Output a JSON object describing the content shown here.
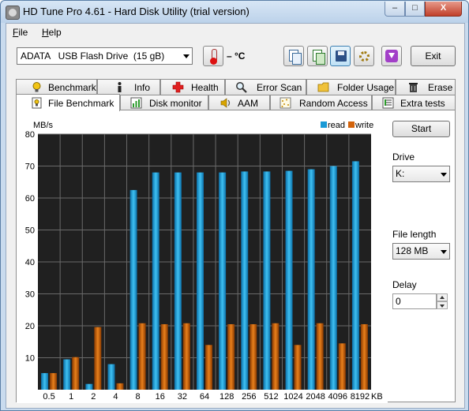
{
  "window": {
    "title": "HD Tune Pro 4.61 - Hard Disk Utility (trial version)",
    "minimize": "–",
    "maximize": "□",
    "close": "X"
  },
  "menu": {
    "file": "F",
    "file_rest": "ile",
    "help": "H",
    "help_rest": "elp"
  },
  "toolbar": {
    "drive_label": "ADATA   USB Flash Drive  (15 gB)",
    "temperature": "– °C",
    "exit_label": "Exit",
    "buttons": [
      "copy-text-icon",
      "copy-screenshot-icon",
      "save-icon",
      "options-icon",
      "download-icon"
    ]
  },
  "tabs_row1": [
    {
      "label": "Benchmark",
      "icon": "lightbulb-icon"
    },
    {
      "label": "Info",
      "icon": "info-icon"
    },
    {
      "label": "Health",
      "icon": "health-cross-icon"
    },
    {
      "label": "Error Scan",
      "icon": "magnifier-icon"
    },
    {
      "label": "Folder Usage",
      "icon": "folder-icon"
    },
    {
      "label": "Erase",
      "icon": "trash-icon"
    }
  ],
  "tabs_row2": [
    {
      "label": "File Benchmark",
      "icon": "file-benchmark-icon",
      "active": true
    },
    {
      "label": "Disk monitor",
      "icon": "disk-monitor-icon"
    },
    {
      "label": "AAM",
      "icon": "speaker-icon"
    },
    {
      "label": "Random Access",
      "icon": "random-access-icon"
    },
    {
      "label": "Extra tests",
      "icon": "extra-tests-icon"
    }
  ],
  "controls": {
    "start_label": "Start",
    "drive_label": "Drive",
    "drive_value": "K:",
    "file_length_label": "File length",
    "file_length_value": "128 MB",
    "delay_label": "Delay",
    "delay_value": "0"
  },
  "colors": {
    "read": "#1a9ad6",
    "write": "#d2630c",
    "plot_bg": "#202020",
    "grid": "#6a6a6a"
  },
  "chart_data": {
    "type": "bar",
    "ylabel": "MB/s",
    "xunit": "KB",
    "ylim": [
      0,
      80
    ],
    "yticks": [
      10,
      20,
      30,
      40,
      50,
      60,
      70,
      80
    ],
    "grid": true,
    "legend_position": "top-right",
    "categories": [
      "0.5",
      "1",
      "2",
      "4",
      "8",
      "16",
      "32",
      "64",
      "128",
      "256",
      "512",
      "1024",
      "2048",
      "4096",
      "8192"
    ],
    "series": [
      {
        "name": "read",
        "values": [
          5.2,
          9.5,
          1.8,
          8.0,
          62.5,
          68.0,
          68.0,
          68.0,
          68.0,
          68.3,
          68.3,
          68.5,
          69.0,
          70.0,
          71.5
        ]
      },
      {
        "name": "write",
        "values": [
          5.2,
          10.2,
          19.6,
          2.0,
          20.8,
          20.5,
          20.8,
          14.0,
          20.5,
          20.5,
          20.8,
          14.0,
          20.8,
          14.5,
          20.5
        ]
      }
    ]
  }
}
